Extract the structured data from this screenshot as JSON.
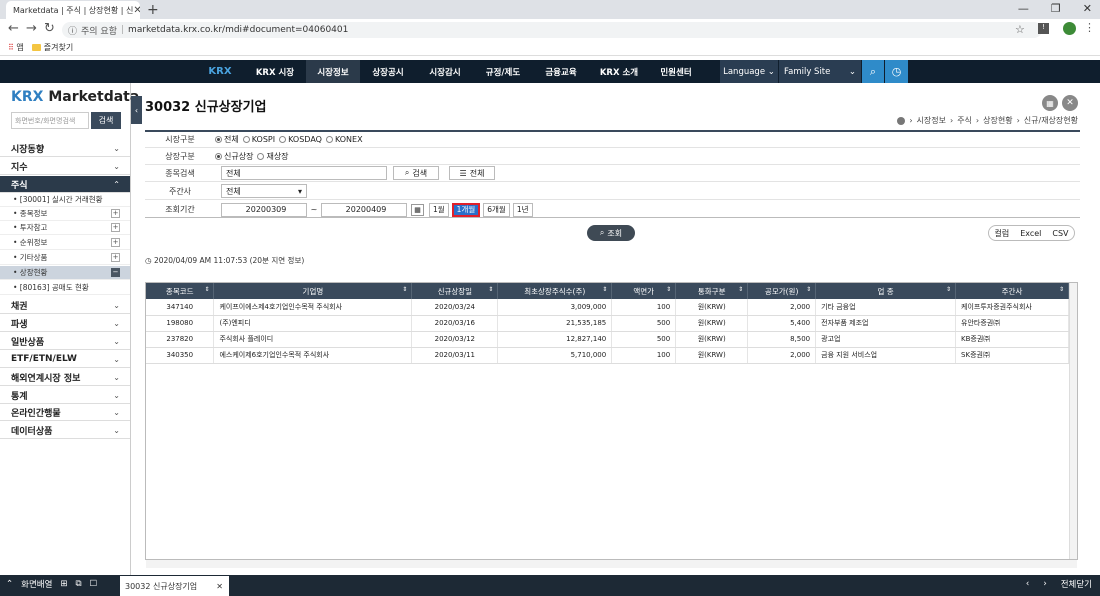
{
  "browser": {
    "tab_title": "Marketdata | 주식 | 상장현황 | 신",
    "address_warning": "주의 요함",
    "url": "marketdata.krx.co.kr/mdi#document=04060401",
    "bookmarks": [
      "앱",
      "즐겨찾기"
    ]
  },
  "topnav": {
    "logo": "KRX",
    "items": [
      "KRX 시장",
      "시장정보",
      "상장공시",
      "시장감시",
      "규정/제도",
      "금융교육",
      "KRX 소개",
      "민원센터"
    ],
    "active": "시장정보",
    "language": "Language",
    "family_site": "Family Site"
  },
  "sidebar": {
    "logo_brand": "KRX",
    "logo_text": "Marketdata",
    "search_placeholder": "화면번호/화면명검색",
    "search_button": "검색",
    "menus": [
      {
        "label": "시장동향"
      },
      {
        "label": "지수"
      },
      {
        "label": "주식"
      }
    ],
    "stock_submenu": [
      {
        "label": "• [30001] 실시간 거래현황"
      },
      {
        "label": "• 종목정보"
      },
      {
        "label": "• 투자참고"
      },
      {
        "label": "• 순위정보"
      },
      {
        "label": "• 기타상품"
      },
      {
        "label": "• 상장현황"
      },
      {
        "label": "• [80163] 공매도 현황"
      }
    ],
    "menus_after": [
      {
        "label": "채권"
      },
      {
        "label": "파생"
      },
      {
        "label": "일반상품"
      },
      {
        "label": "ETF/ETN/ELW"
      },
      {
        "label": "해외연계시장 정보"
      },
      {
        "label": "통계"
      },
      {
        "label": "온라인간행물"
      },
      {
        "label": "데이터상품"
      }
    ]
  },
  "page": {
    "title": "30032 신규상장기업",
    "breadcrumb": [
      "시장정보",
      "주식",
      "상장현황",
      "신규/재상장현황"
    ]
  },
  "form": {
    "market_label": "시장구분",
    "market_options": [
      "전체",
      "KOSPI",
      "KOSDAQ",
      "KONEX"
    ],
    "market_selected": "전체",
    "listing_label": "상장구분",
    "listing_options": [
      "신규상장",
      "재상장"
    ],
    "listing_selected": "신규상장",
    "stock_search_label": "종목검색",
    "stock_search_value": "전체",
    "search_button": "검색",
    "all_button": "전체",
    "underwriter_label": "주간사",
    "underwriter_value": "전체",
    "period_label": "조회기간",
    "from_date": "20200309",
    "tilde": "~",
    "to_date": "20200409",
    "period_buttons": [
      "1월",
      "1개월",
      "6개월",
      "1년"
    ],
    "period_selected": "1개월",
    "query_button": "조회",
    "export": [
      "컬럼",
      "Excel",
      "CSV"
    ]
  },
  "asof": "2020/04/09 AM 11:07:53 (20분 지연 정보)",
  "table": {
    "headers": [
      "종목코드",
      "기업명",
      "신규상장일",
      "최초상장주식수(주)",
      "액면가",
      "통화구분",
      "공모가(원)",
      "업 종",
      "주간사"
    ],
    "rows": [
      [
        "347140",
        "케이프이에스제4호기업인수목적 주식회사",
        "2020/03/24",
        "3,009,000",
        "100",
        "원(KRW)",
        "2,000",
        "기타 금융업",
        "케이프투자증권주식회사"
      ],
      [
        "198080",
        "(주)엔피디",
        "2020/03/16",
        "21,535,185",
        "500",
        "원(KRW)",
        "5,400",
        "전자부품 제조업",
        "유안타증권㈜"
      ],
      [
        "237820",
        "주식회사 플레이디",
        "2020/03/12",
        "12,827,140",
        "500",
        "원(KRW)",
        "8,500",
        "광고업",
        "KB증권㈜"
      ],
      [
        "340350",
        "에스케이제6호기업인수목적 주식회사",
        "2020/03/11",
        "5,710,000",
        "100",
        "원(KRW)",
        "2,000",
        "금융 지원 서비스업",
        "SK증권㈜"
      ]
    ]
  },
  "bottombar": {
    "layout_label": "화면배열",
    "open_tab": "30032 신규상장기업",
    "close_all": "전체닫기"
  }
}
